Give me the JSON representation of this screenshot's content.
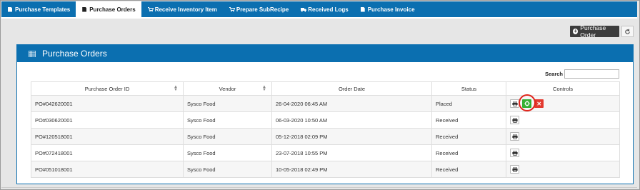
{
  "tabs": [
    {
      "label": "Purchase Templates",
      "icon": "document-icon",
      "active": false
    },
    {
      "label": "Purchase Orders",
      "icon": "document-icon",
      "active": true
    },
    {
      "label": "Receive Inventory Item",
      "icon": "cart-icon",
      "active": false
    },
    {
      "label": "Prepare SubRecipe",
      "icon": "cart-icon",
      "active": false
    },
    {
      "label": "Received Logs",
      "icon": "truck-icon",
      "active": false
    },
    {
      "label": "Purchase Invoice",
      "icon": "document-icon",
      "active": false
    }
  ],
  "toolbar": {
    "add_label": "Purchase Order",
    "add_icon": "plus-circle-icon",
    "refresh_icon": "refresh-icon"
  },
  "panel": {
    "title": "Purchase Orders",
    "icon": "grid-icon"
  },
  "search": {
    "label": "Search",
    "value": ""
  },
  "table": {
    "columns": [
      "Purchase Order ID",
      "Vendor",
      "Order Date",
      "Status",
      "Controls"
    ],
    "rows": [
      {
        "id": "PO#042620001",
        "vendor": "Sysco Food",
        "date": "26-04-2020 06:45 AM",
        "status": "Placed",
        "controls": [
          "print",
          "receive",
          "delete"
        ]
      },
      {
        "id": "PO#030620001",
        "vendor": "Sysco Food",
        "date": "06-03-2020 10:50 AM",
        "status": "Received",
        "controls": [
          "print"
        ]
      },
      {
        "id": "PO#120518001",
        "vendor": "Sysco Food",
        "date": "05-12-2018 02:09 PM",
        "status": "Received",
        "controls": [
          "print"
        ]
      },
      {
        "id": "PO#072418001",
        "vendor": "Sysco Food",
        "date": "23-07-2018 10:55 PM",
        "status": "Received",
        "controls": [
          "print"
        ]
      },
      {
        "id": "PO#051018001",
        "vendor": "Sysco Food",
        "date": "10-05-2018 02:49 PM",
        "status": "Received",
        "controls": [
          "print"
        ]
      }
    ]
  },
  "colors": {
    "brand": "#0b6fb0",
    "receive": "#35b035",
    "delete": "#e33a2f",
    "highlight_ring": "#e0241a"
  }
}
